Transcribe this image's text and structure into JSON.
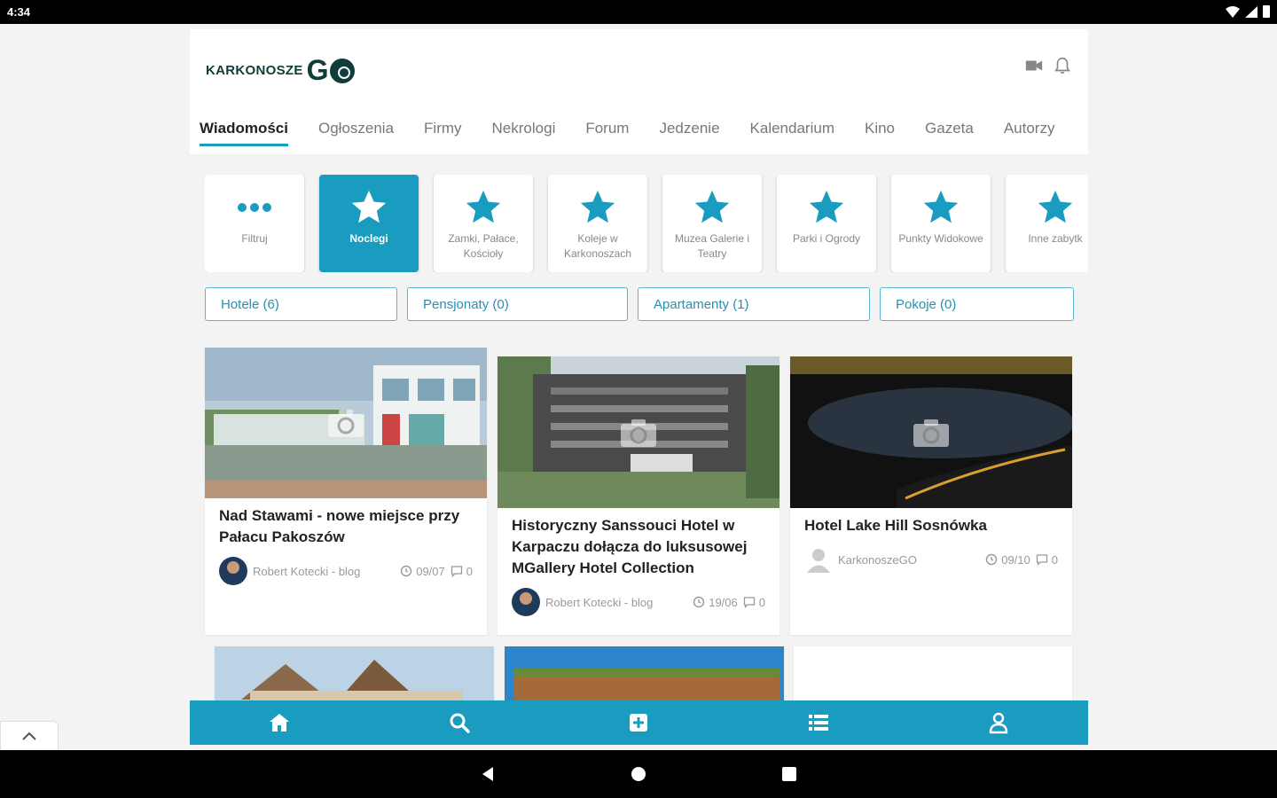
{
  "status": {
    "time": "4:34"
  },
  "header": {
    "logo_text": "KARKONOSZE",
    "logo_go": "G"
  },
  "tabs": [
    {
      "label": "Wiadomości",
      "active": true
    },
    {
      "label": "Ogłoszenia"
    },
    {
      "label": "Firmy"
    },
    {
      "label": "Nekrologi"
    },
    {
      "label": "Forum"
    },
    {
      "label": "Jedzenie"
    },
    {
      "label": "Kalendarium"
    },
    {
      "label": "Kino"
    },
    {
      "label": "Gazeta"
    },
    {
      "label": "Autorzy"
    }
  ],
  "categories": [
    {
      "label": "Filtruj",
      "icon": "dots-icon"
    },
    {
      "label": "Noclegi",
      "icon": "star-icon",
      "active": true
    },
    {
      "label": "Zamki, Pałace, Kościoły",
      "icon": "star-icon"
    },
    {
      "label": "Koleje w Karkonoszach",
      "icon": "star-icon"
    },
    {
      "label": "Muzea Galerie i Teatry",
      "icon": "star-icon"
    },
    {
      "label": "Parki i Ogrody",
      "icon": "star-icon"
    },
    {
      "label": "Punkty Widokowe",
      "icon": "star-icon"
    },
    {
      "label": "Inne zabytk",
      "icon": "star-icon"
    }
  ],
  "chips": [
    {
      "label": "Hotele (6)"
    },
    {
      "label": "Pensjonaty (0)"
    },
    {
      "label": "Apartamenty (1)"
    },
    {
      "label": "Pokoje (0)"
    }
  ],
  "cards": [
    {
      "title": "Nad Stawami - nowe miejsce przy Pałacu Pakoszów",
      "author": "Robert Kotecki - blog",
      "date": "09/07",
      "comments": "0"
    },
    {
      "title": "Historyczny Sanssouci Hotel w Karpaczu dołącza do luksusowej MGallery Hotel Collection",
      "author": "Robert Kotecki - blog",
      "date": "19/06",
      "comments": "0"
    },
    {
      "title": "Hotel Lake Hill Sosnówka",
      "author": "KarkonoszeGO",
      "date": "09/10",
      "comments": "0"
    }
  ],
  "colors": {
    "accent": "#1a9cc0",
    "brand": "#0f3d3a"
  }
}
